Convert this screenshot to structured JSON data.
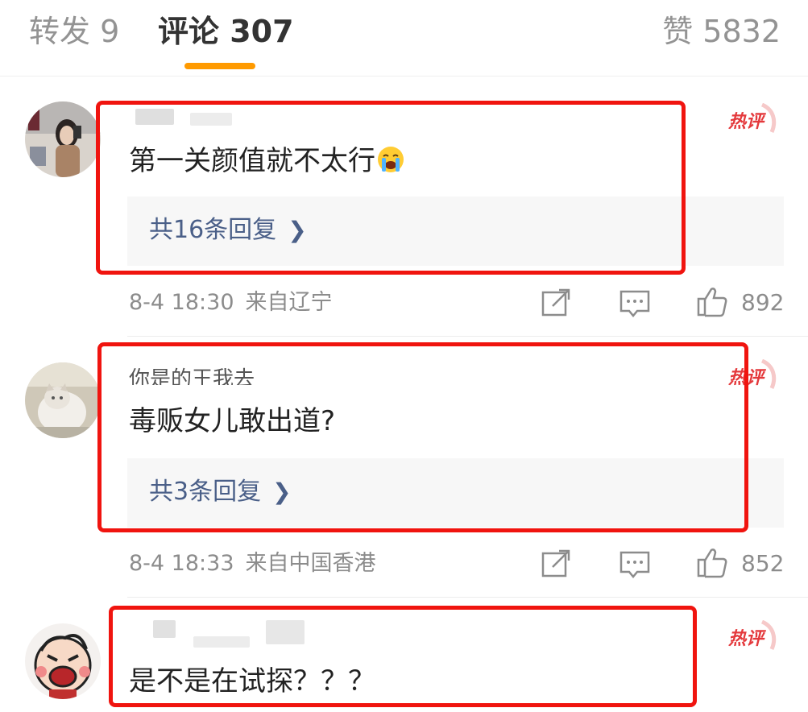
{
  "tabs": {
    "repost": "转发 9",
    "comments": "评论 307",
    "likes": "赞 5832"
  },
  "colors": {
    "tab_indicator": "#ff9a00",
    "highlight_box": "#f0140f",
    "reply_link": "#4a5f88",
    "hot_badge": "#e4393c"
  },
  "comments": [
    {
      "username": "",
      "text": "第一关颜值就不太行",
      "emoji": "loudly-crying-face",
      "replies_label": "共16条回复",
      "time": "8-4 18:30",
      "source": "来自辽宁",
      "likes": "892",
      "hot_badge": "热评"
    },
    {
      "username": "你是的王我去",
      "text": "毒贩女儿敢出道?",
      "replies_label": "共3条回复",
      "time": "8-4 18:33",
      "source": "来自中国香港",
      "likes": "852",
      "hot_badge": "热评"
    },
    {
      "username": "",
      "text": "是不是在试探？？？",
      "hot_badge": "热评"
    }
  ],
  "icons": {
    "reply_chevron": "chevron-right-icon",
    "share": "share-icon",
    "comment": "comment-icon",
    "like": "thumbs-up-icon"
  }
}
